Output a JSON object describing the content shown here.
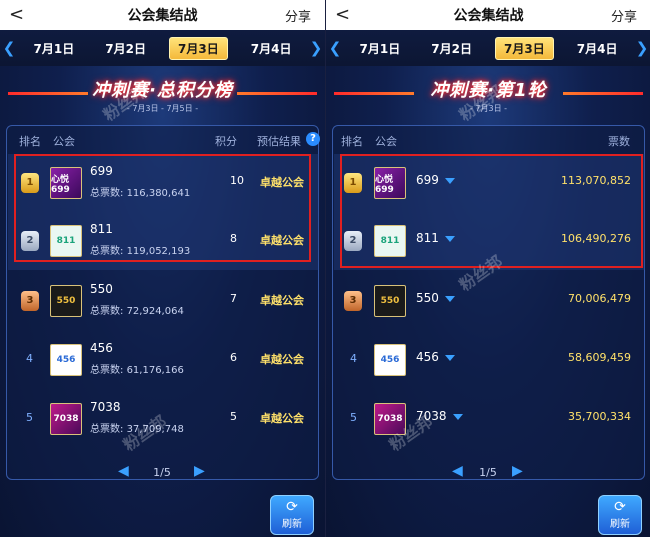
{
  "left": {
    "header": {
      "back": "<",
      "title": "公会集结战",
      "share": "分享"
    },
    "dates": [
      "7月1日",
      "7月2日",
      "7月3日",
      "7月4日"
    ],
    "active_date_index": 2,
    "banner": {
      "title": "冲刺赛·总积分榜",
      "subtitle": "- 7月3日 - 7月5日 -"
    },
    "columns": {
      "rank": "排名",
      "guild": "公会",
      "score": "积分",
      "result": "预估结果",
      "help": "?"
    },
    "rows": [
      {
        "rank": "1",
        "name": "699",
        "votes_label": "总票数:",
        "votes": "116,380,641",
        "score": "10",
        "result": "卓越公会",
        "logo": "心悦699"
      },
      {
        "rank": "2",
        "name": "811",
        "votes_label": "总票数:",
        "votes": "119,052,193",
        "score": "8",
        "result": "卓越公会",
        "logo": "811"
      },
      {
        "rank": "3",
        "name": "550",
        "votes_label": "总票数:",
        "votes": "72,924,064",
        "score": "7",
        "result": "卓越公会",
        "logo": "550"
      },
      {
        "rank": "4",
        "name": "456",
        "votes_label": "总票数:",
        "votes": "61,176,166",
        "score": "6",
        "result": "卓越公会",
        "logo": "456"
      },
      {
        "rank": "5",
        "name": "7038",
        "votes_label": "总票数:",
        "votes": "37,709,748",
        "score": "5",
        "result": "卓越公会",
        "logo": "7038"
      }
    ],
    "pager": {
      "text": "1/5"
    },
    "refresh_label": "刷新",
    "watermark": "粉丝邦"
  },
  "right": {
    "header": {
      "back": "<",
      "title": "公会集结战",
      "share": "分享"
    },
    "dates": [
      "7月1日",
      "7月2日",
      "7月3日",
      "7月4日"
    ],
    "active_date_index": 2,
    "banner": {
      "title": "冲刺赛·第1轮",
      "subtitle": "- 7月3日 -"
    },
    "columns": {
      "rank": "排名",
      "guild": "公会",
      "votes": "票数"
    },
    "rows": [
      {
        "rank": "1",
        "name": "699",
        "votes": "113,070,852",
        "logo": "心悦699"
      },
      {
        "rank": "2",
        "name": "811",
        "votes": "106,490,276",
        "logo": "811"
      },
      {
        "rank": "3",
        "name": "550",
        "votes": "70,006,479",
        "logo": "550"
      },
      {
        "rank": "4",
        "name": "456",
        "votes": "58,609,459",
        "logo": "456"
      },
      {
        "rank": "5",
        "name": "7038",
        "votes": "35,700,334",
        "logo": "7038"
      }
    ],
    "pager": {
      "text": "1/5"
    },
    "refresh_label": "刷新",
    "watermark": "粉丝邦"
  },
  "colors": {
    "highlight_box": "#e02020",
    "accent_blue": "#3aa0ff",
    "gold_text": "#ffe16a"
  }
}
